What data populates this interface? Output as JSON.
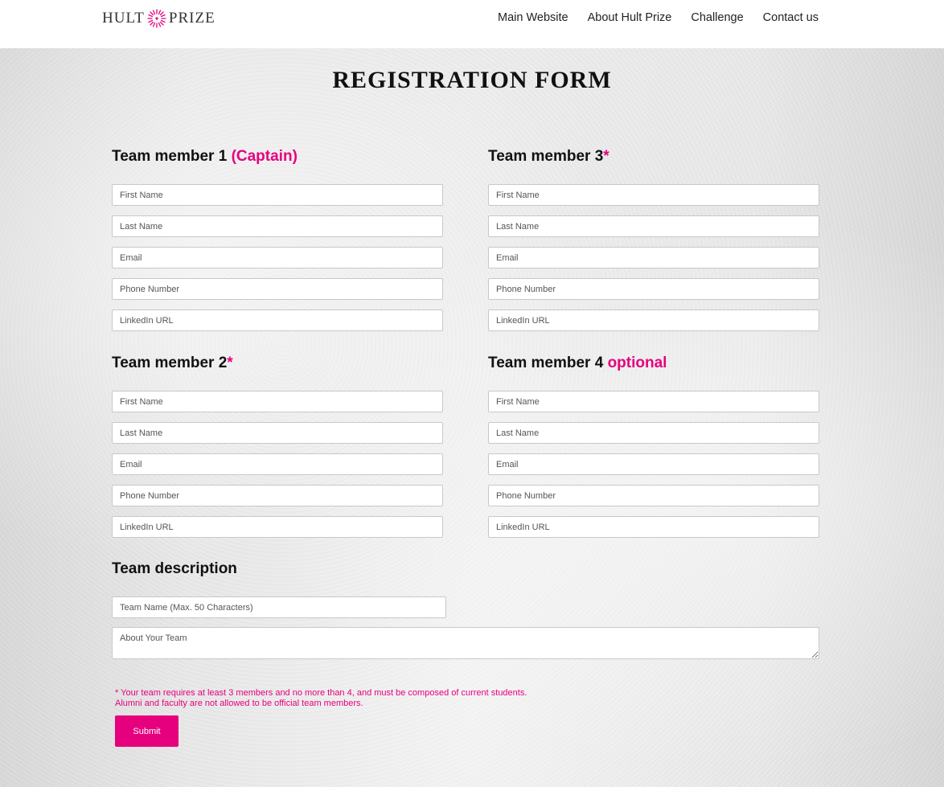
{
  "header": {
    "logo_text_left": "HULT",
    "logo_text_right": "PRIZE",
    "nav": [
      {
        "label": "Main Website"
      },
      {
        "label": "About Hult Prize"
      },
      {
        "label": "Challenge"
      },
      {
        "label": "Contact us"
      }
    ]
  },
  "form": {
    "title": "REGISTRATION FORM",
    "members": [
      {
        "heading": "Team member 1",
        "accent": "(Captain)"
      },
      {
        "heading": "Team member 2",
        "accent": "*"
      },
      {
        "heading": "Team member 3",
        "accent": "*"
      },
      {
        "heading": "Team member 4",
        "accent": "optional"
      }
    ],
    "fields": {
      "first_name": "First Name",
      "last_name": "Last Name",
      "email": "Email",
      "phone": "Phone Number",
      "linkedin": "LinkedIn URL"
    },
    "team": {
      "heading": "Team description",
      "name_placeholder": "Team Name (Max. 50 Characters)",
      "about_placeholder": "About Your Team"
    },
    "note_line1": "* Your team requires at least 3 members and no more than 4, and must be composed of current students.",
    "note_line2": "Alumni and faculty are not allowed to be official team members.",
    "submit_label": "Submit"
  },
  "colors": {
    "accent": "#e6007e",
    "header_bg": "#ffffff"
  }
}
